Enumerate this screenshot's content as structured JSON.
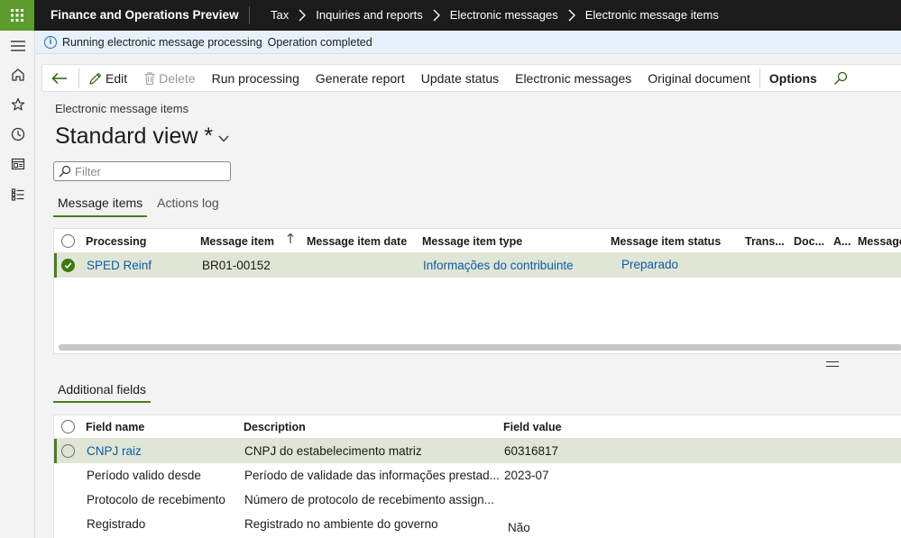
{
  "topbar": {
    "app_title": "Finance and Operations Preview",
    "breadcrumbs": [
      "Tax",
      "Inquiries and reports",
      "Electronic messages",
      "Electronic message items"
    ]
  },
  "message_bar": {
    "text": "Running electronic message processing",
    "status": "Operation completed",
    "icon": "info-icon"
  },
  "actions": {
    "edit": "Edit",
    "delete": "Delete",
    "run_processing": "Run processing",
    "generate_report": "Generate report",
    "update_status": "Update status",
    "electronic_messages": "Electronic messages",
    "original_document": "Original document",
    "options": "Options"
  },
  "page": {
    "caption": "Electronic message items",
    "view_title": "Standard view *",
    "filter_placeholder": "Filter"
  },
  "tabs": [
    "Message items",
    "Actions log"
  ],
  "grid": {
    "columns": [
      "Processing",
      "Message item",
      "Message item date",
      "Message item type",
      "Message item status",
      "Trans...",
      "Doc...",
      "A...",
      "Message"
    ],
    "rows": [
      {
        "processing": "SPED Reinf",
        "message_item": "BR01-00152",
        "message_item_date": "",
        "message_item_type": "Informações do contribuinte",
        "message_item_status": "Preparado"
      }
    ]
  },
  "additional_fields": {
    "tab_label": "Additional fields",
    "columns": [
      "Field name",
      "Description",
      "Field value"
    ],
    "rows": [
      {
        "field_name": "CNPJ raiz",
        "description": "CNPJ do estabelecimento matriz",
        "field_value": "60316817"
      },
      {
        "field_name": "Período valido desde",
        "description": "Período de validade das informações prestad...",
        "field_value": "2023-07"
      },
      {
        "field_name": "Protocolo de recebimento",
        "description": "Número de protocolo de recebimento assign...",
        "field_value": ""
      },
      {
        "field_name": "Registrado",
        "description": "Registrado no ambiente do governo",
        "field_value": "Não"
      }
    ]
  },
  "colors": {
    "accent_green": "#4a7d1d",
    "waffle_green": "#5b9c2d",
    "link_blue": "#0f5aa8",
    "topbar": "#1b1b1b"
  }
}
